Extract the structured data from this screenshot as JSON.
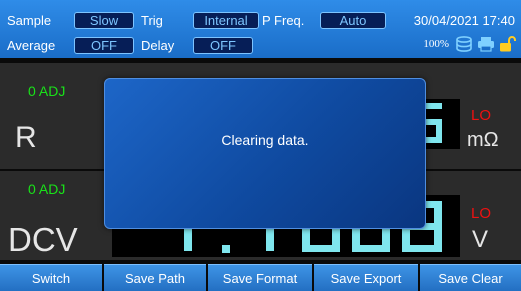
{
  "header": {
    "sample_label": "Sample",
    "sample_value": "Slow",
    "trig_label": "Trig",
    "trig_value": "Internal",
    "pfreq_label": "P Freq.",
    "pfreq_value": "Auto",
    "average_label": "Average",
    "average_value": "OFF",
    "delay_label": "Delay",
    "delay_value": "OFF",
    "datetime": "30/04/2021 17:40",
    "battery_percent": "100%",
    "status_icons": [
      "database-icon",
      "printer-icon",
      "unlock-icon"
    ]
  },
  "panel1": {
    "adj": "0 ADJ",
    "function": "R",
    "range": "LO",
    "unit": "mΩ"
  },
  "panel2": {
    "adj": "0 ADJ",
    "function": "DCV",
    "range": "LO",
    "unit": "V"
  },
  "modal": {
    "message": "Clearing data."
  },
  "buttons": [
    "Switch",
    "Save Path",
    "Save Format",
    "Save Export",
    "Save Clear"
  ],
  "colors": {
    "header_blue": "#1f78d6",
    "pill_fill": "#061e57",
    "pill_text": "#7ec6ff",
    "adj_green": "#19e219",
    "range_red": "#ee1111",
    "segment_cyan": "#7fe6ee"
  }
}
